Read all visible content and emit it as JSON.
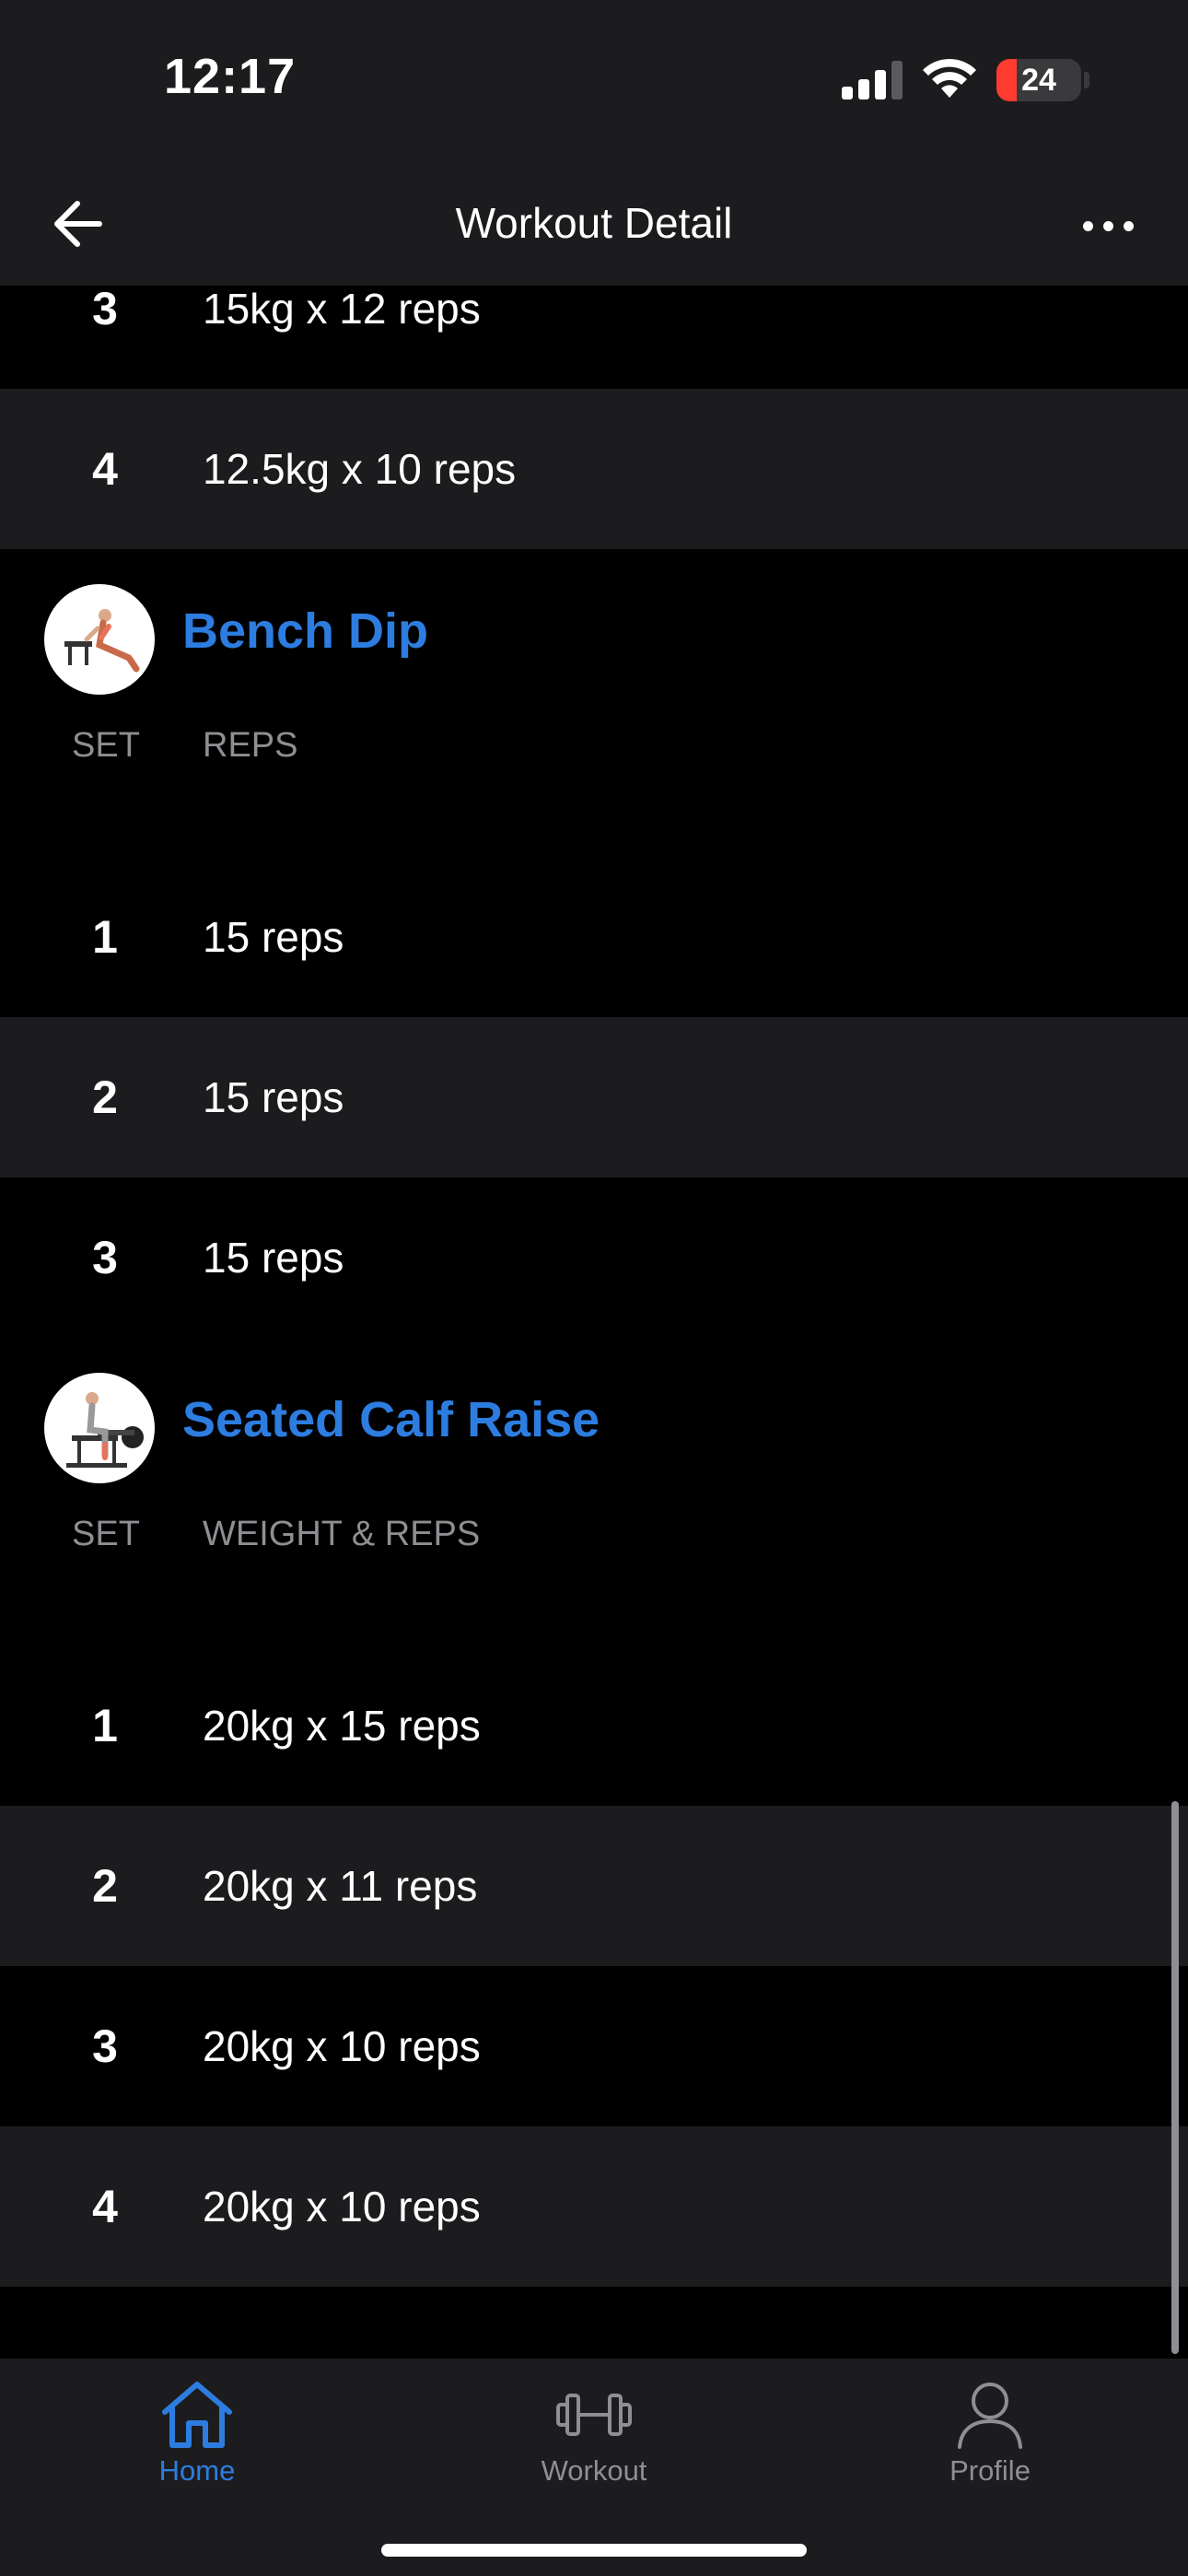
{
  "status": {
    "time": "12:17",
    "battery_level": "24",
    "battery_fraction": 0.24
  },
  "nav": {
    "title": "Workout Detail"
  },
  "top_sets": [
    {
      "set": "3",
      "value": "15kg x 12 reps"
    },
    {
      "set": "4",
      "value": "12.5kg x 10 reps"
    }
  ],
  "exercises": [
    {
      "name": "Bench Dip",
      "col_set": "SET",
      "col_value": "REPS",
      "sets": [
        {
          "set": "1",
          "value": "15 reps"
        },
        {
          "set": "2",
          "value": "15 reps"
        },
        {
          "set": "3",
          "value": "15 reps"
        }
      ]
    },
    {
      "name": "Seated Calf Raise",
      "col_set": "SET",
      "col_value": "WEIGHT & REPS",
      "sets": [
        {
          "set": "1",
          "value": "20kg x 15 reps"
        },
        {
          "set": "2",
          "value": "20kg x 11 reps"
        },
        {
          "set": "3",
          "value": "20kg x 10 reps"
        },
        {
          "set": "4",
          "value": "20kg x 10 reps"
        }
      ]
    }
  ],
  "tabs": [
    {
      "label": "Home",
      "icon": "home-icon",
      "active": true
    },
    {
      "label": "Workout",
      "icon": "dumbbell-icon",
      "active": false
    },
    {
      "label": "Profile",
      "icon": "person-icon",
      "active": false
    }
  ],
  "colors": {
    "accent": "#2d7de0",
    "background": "#000000",
    "row_alt": "#1c1c1e",
    "muted": "#8e8e93"
  }
}
